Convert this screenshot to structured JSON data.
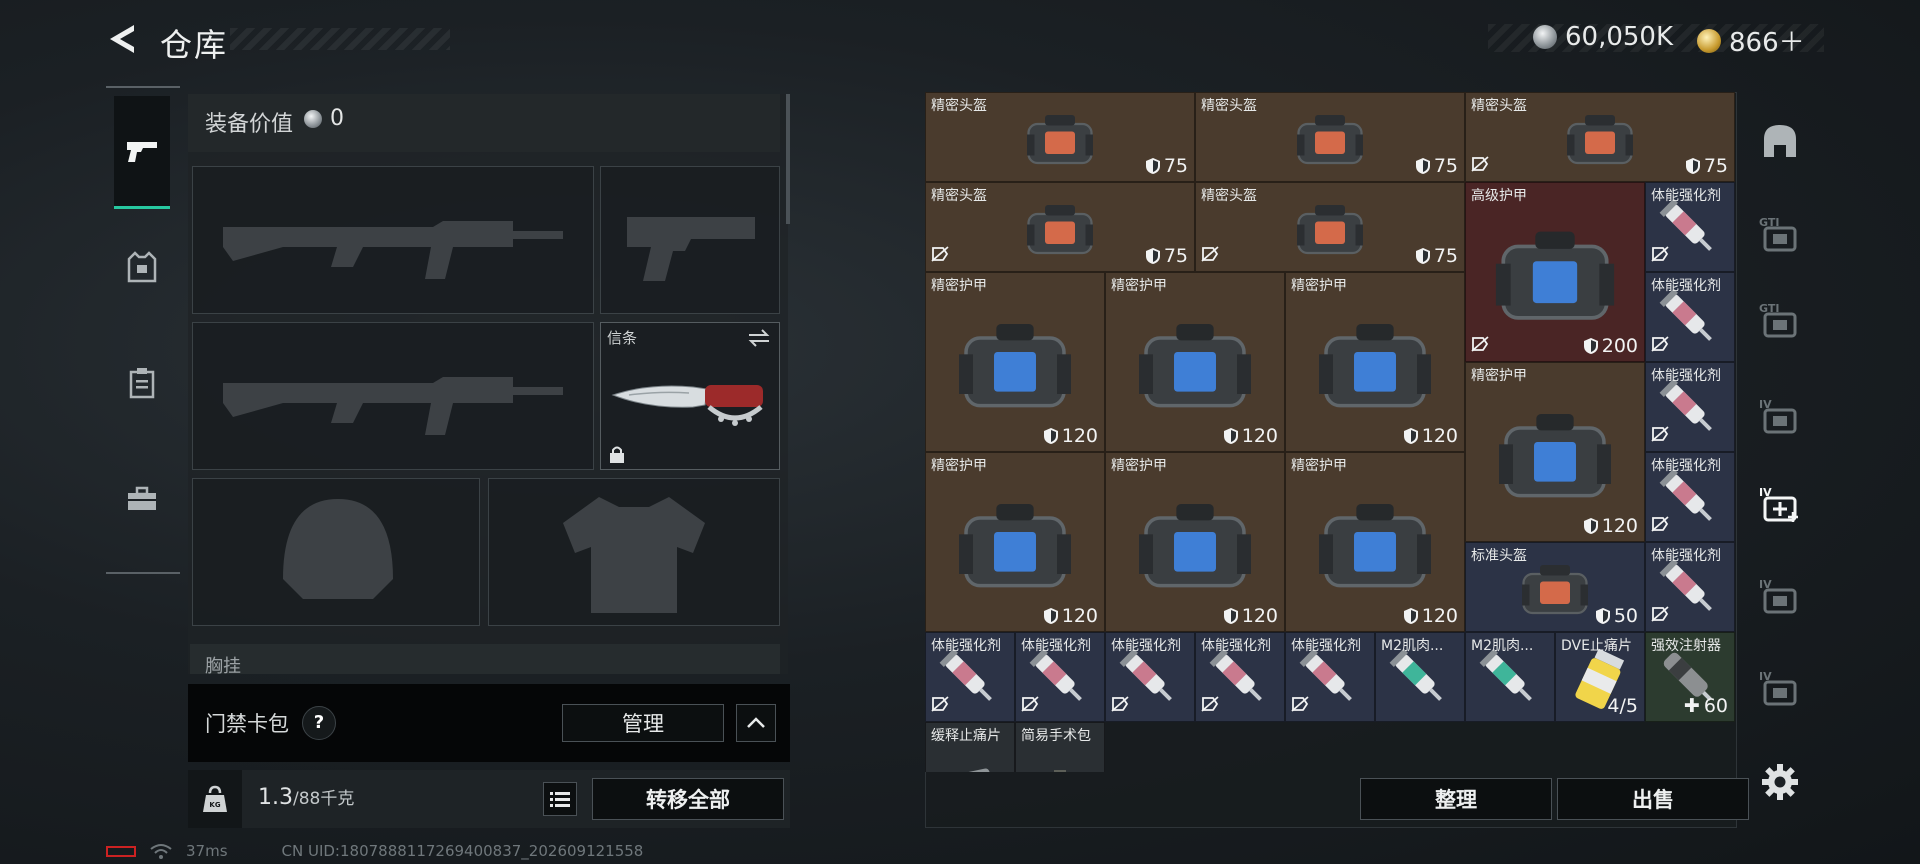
{
  "header": {
    "title": "仓库",
    "currency": [
      {
        "icon": "silver-coin-icon",
        "value": "60,050K"
      },
      {
        "icon": "gold-coin-icon",
        "value": "866＋"
      }
    ]
  },
  "side_tabs": [
    {
      "name": "weapons",
      "icon": "pistol-icon",
      "active": true
    },
    {
      "name": "armor",
      "icon": "armor-vest-icon",
      "active": false
    },
    {
      "name": "backpack",
      "icon": "clipboard-icon",
      "active": false
    },
    {
      "name": "supplies",
      "icon": "toolbox-icon",
      "active": false
    }
  ],
  "loadout": {
    "value_label": "装备价值",
    "value": "0",
    "melee_slot_label": "信条",
    "chest_rig_label": "胸挂",
    "keycard_label": "门禁卡包",
    "help_label": "?",
    "manage_label": "管理",
    "weight_current": "1.3",
    "weight_max": "/88千克",
    "transfer_all_label": "转移全部"
  },
  "status": {
    "ping": "37ms",
    "uid": "CN UID:1807888117269400837_202609121558"
  },
  "stash": {
    "sort_label": "整理",
    "sell_label": "出售",
    "items": [
      {
        "name": "精密头盔",
        "type": "helmet",
        "color": "brown",
        "durability": "75",
        "unmarked": false
      },
      {
        "name": "精密头盔",
        "type": "helmet",
        "color": "brown",
        "durability": "75",
        "unmarked": false
      },
      {
        "name": "精密头盔",
        "type": "helmet",
        "color": "brown",
        "durability": "75",
        "unmarked": true
      },
      {
        "name": "精密头盔",
        "type": "helmet",
        "color": "brown",
        "durability": "75",
        "unmarked": true
      },
      {
        "name": "精密头盔",
        "type": "helmet",
        "color": "brown",
        "durability": "75",
        "unmarked": true
      },
      {
        "name": "高级护甲",
        "type": "armor-large",
        "color": "red",
        "durability": "200",
        "unmarked": true
      },
      {
        "name": "体能强化剂",
        "type": "syringe",
        "color": "blue",
        "durability": "",
        "unmarked": true
      },
      {
        "name": "体能强化剂",
        "type": "syringe",
        "color": "blue",
        "durability": "",
        "unmarked": true
      },
      {
        "name": "精密护甲",
        "type": "armor",
        "color": "brown",
        "durability": "120",
        "unmarked": false
      },
      {
        "name": "精密护甲",
        "type": "armor",
        "color": "brown",
        "durability": "120",
        "unmarked": false
      },
      {
        "name": "精密护甲",
        "type": "armor",
        "color": "brown",
        "durability": "120",
        "unmarked": false
      },
      {
        "name": "精密护甲",
        "type": "armor",
        "color": "brown",
        "durability": "120",
        "unmarked": false
      },
      {
        "name": "体能强化剂",
        "type": "syringe",
        "color": "blue",
        "durability": "",
        "unmarked": true
      },
      {
        "name": "体能强化剂",
        "type": "syringe",
        "color": "blue",
        "durability": "",
        "unmarked": true
      },
      {
        "name": "精密护甲",
        "type": "armor",
        "color": "brown",
        "durability": "120",
        "unmarked": false
      },
      {
        "name": "精密护甲",
        "type": "armor",
        "color": "brown",
        "durability": "120",
        "unmarked": false
      },
      {
        "name": "精密护甲",
        "type": "armor",
        "color": "brown",
        "durability": "120",
        "unmarked": false
      },
      {
        "name": "标准头盔",
        "type": "helmet",
        "color": "blue",
        "durability": "50",
        "unmarked": false
      },
      {
        "name": "体能强化剂",
        "type": "syringe",
        "color": "blue",
        "durability": "",
        "unmarked": true
      },
      {
        "name": "体能强化剂",
        "type": "syringe",
        "color": "blue",
        "durability": "",
        "unmarked": true
      },
      {
        "name": "体能强化剂",
        "type": "syringe",
        "color": "blue",
        "durability": "",
        "unmarked": true
      },
      {
        "name": "体能强化剂",
        "type": "syringe",
        "color": "blue",
        "durability": "",
        "unmarked": true
      },
      {
        "name": "体能强化剂",
        "type": "syringe",
        "color": "blue",
        "durability": "",
        "unmarked": true
      },
      {
        "name": "体能强化剂",
        "type": "syringe",
        "color": "blue",
        "durability": "",
        "unmarked": true
      },
      {
        "name": "M2肌肉...",
        "type": "syringe-teal",
        "color": "blue",
        "durability": "",
        "unmarked": false
      },
      {
        "name": "M2肌肉...",
        "type": "syringe-teal",
        "color": "blue",
        "durability": "",
        "unmarked": false
      },
      {
        "name": "DVE止痛片",
        "type": "pills",
        "color": "blue",
        "durability": "4/5",
        "unmarked": false
      },
      {
        "name": "强效注射器",
        "type": "injector",
        "color": "green",
        "durability": "60",
        "unmarked": false
      },
      {
        "name": "缓释止痛片",
        "type": "pills-flat",
        "color": "dark",
        "durability": "",
        "unmarked": false
      },
      {
        "name": "简易手术包",
        "type": "kit",
        "color": "dark",
        "durability": "",
        "unmarked": false
      }
    ]
  },
  "categories": [
    {
      "icon": "helmet-category-icon",
      "label": ""
    },
    {
      "icon": "gti-rig-icon",
      "label": "GTI"
    },
    {
      "icon": "gti-armor-icon",
      "label": "GTI"
    },
    {
      "icon": "iv-backpack-icon",
      "label": "IV"
    },
    {
      "icon": "iv-medkit-icon",
      "label": "IV"
    },
    {
      "icon": "iv-injector-icon",
      "label": "IV"
    },
    {
      "icon": "iv-tool-icon",
      "label": "IV"
    }
  ],
  "colors": {
    "accent": "#27c8a0",
    "brown_tier": "#4a3b2d",
    "red_tier": "#4a2525",
    "blue_tier": "#2c3346",
    "green_tier": "#2c3b2f"
  }
}
